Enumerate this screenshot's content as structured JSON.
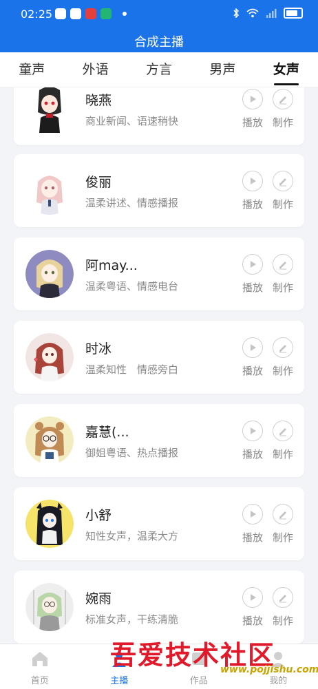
{
  "status_bar": {
    "time": "02:25"
  },
  "header": {
    "title": "合成主播"
  },
  "tabs": [
    {
      "label": "童声"
    },
    {
      "label": "外语"
    },
    {
      "label": "方言"
    },
    {
      "label": "男声"
    },
    {
      "label": "女声",
      "active": true
    }
  ],
  "actions": {
    "play_label": "播放",
    "make_label": "制作"
  },
  "voices": [
    {
      "name": "晓燕",
      "desc": "商业新闻、语速稍快"
    },
    {
      "name": "俊丽",
      "desc": "温柔讲述、情感播报"
    },
    {
      "name": "阿may...",
      "desc": "温柔粤语、情感电台"
    },
    {
      "name": "时冰",
      "desc": "温柔知性　情感旁白"
    },
    {
      "name": "嘉慧(...",
      "desc": "御姐粤语、热点播报"
    },
    {
      "name": "小舒",
      "desc": "知性女声，温柔大方"
    },
    {
      "name": "婉雨",
      "desc": "标准女声，干练清脆"
    }
  ],
  "bottom_nav": [
    {
      "label": "首页"
    },
    {
      "label": "主播",
      "active": true
    },
    {
      "label": "作品"
    },
    {
      "label": "我的"
    }
  ],
  "watermark": {
    "text": "吾爱技术社区",
    "url": "www.pojjishu.com"
  },
  "colors": {
    "primary": "#1a73e8",
    "watermark_red": "#e0192b"
  }
}
